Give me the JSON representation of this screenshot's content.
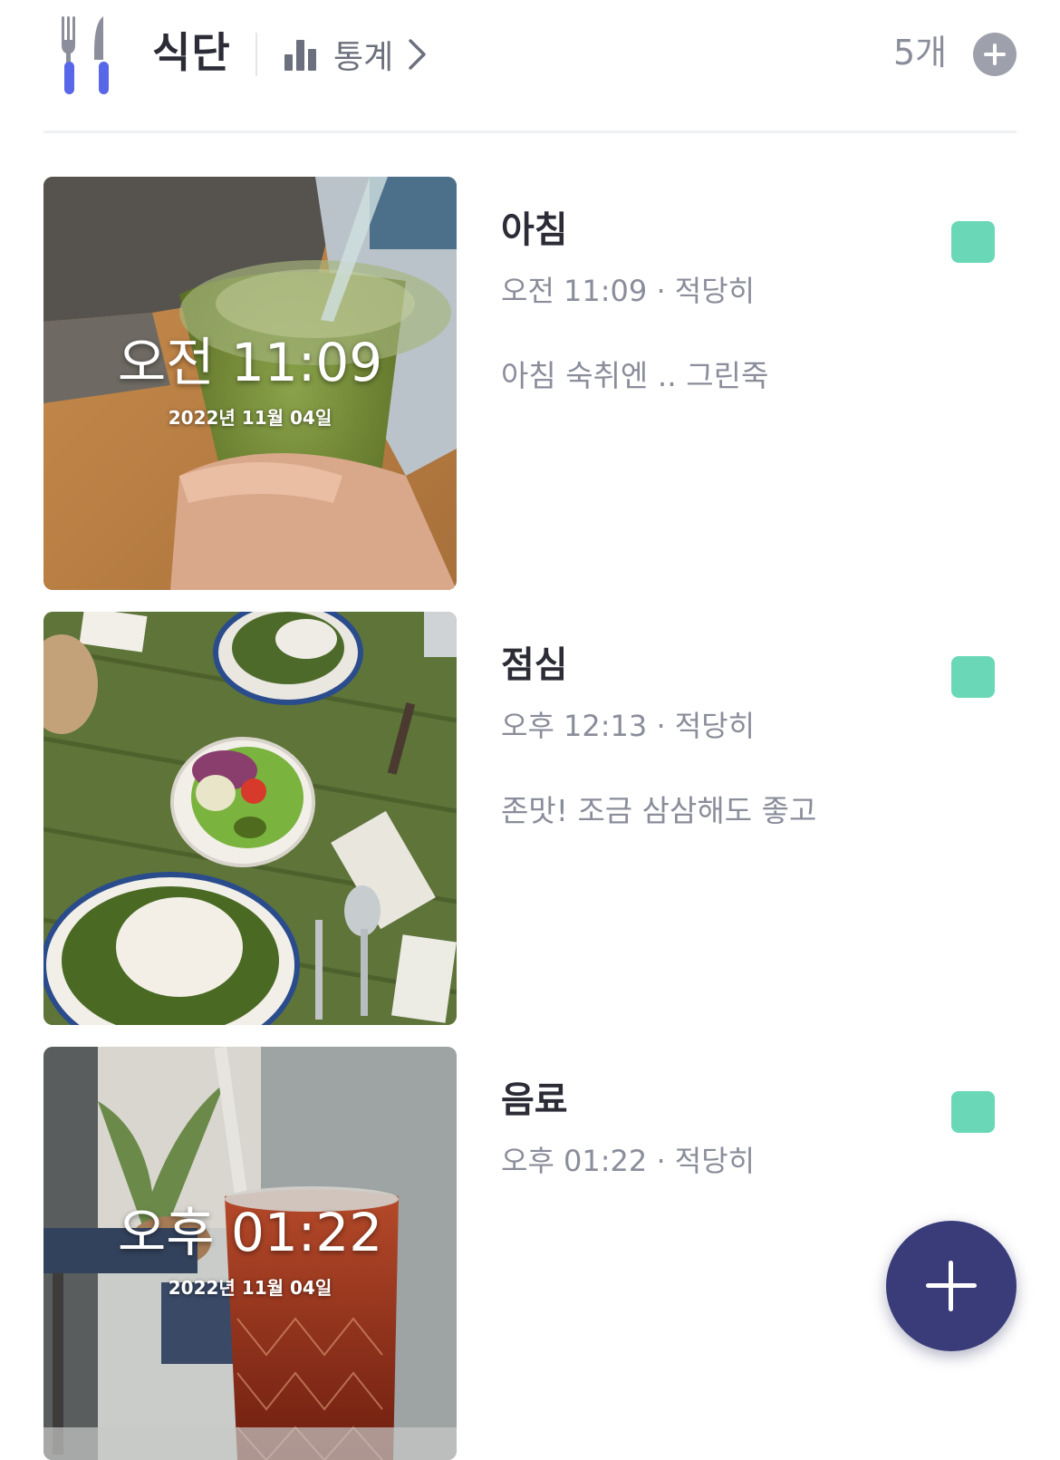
{
  "header": {
    "title": "식단",
    "stats_label": "통계",
    "count": "5개",
    "icons": {
      "app": "fork-knife-icon",
      "stats": "bar-chart-icon",
      "chevron": "chevron-right-icon",
      "add": "plus-circle-icon"
    }
  },
  "meals": [
    {
      "name": "아침",
      "meta": "오전 11:09 · 적당히",
      "memo": "아침 숙취엔 .. 그린죽",
      "photo_time": "오전 11:09",
      "photo_date": "2022년 11월 04일",
      "tag_color": "#6ad8b7"
    },
    {
      "name": "점심",
      "meta": "오후 12:13 · 적당히",
      "memo": "존맛! 조금 삼삼해도 좋고",
      "photo_time": "",
      "photo_date": "",
      "tag_color": "#6ad8b7"
    },
    {
      "name": "음료",
      "meta": "오후 01:22 · 적당히",
      "memo": "",
      "photo_time": "오후 01:22",
      "photo_date": "2022년 11월 04일",
      "tag_color": "#6ad8b7"
    }
  ],
  "fab": {
    "icon": "plus-icon"
  },
  "colors": {
    "accent": "#393c79",
    "fork_handle": "#5867e8",
    "tag": "#6ad8b7",
    "muted_text": "#8a8d9a"
  }
}
